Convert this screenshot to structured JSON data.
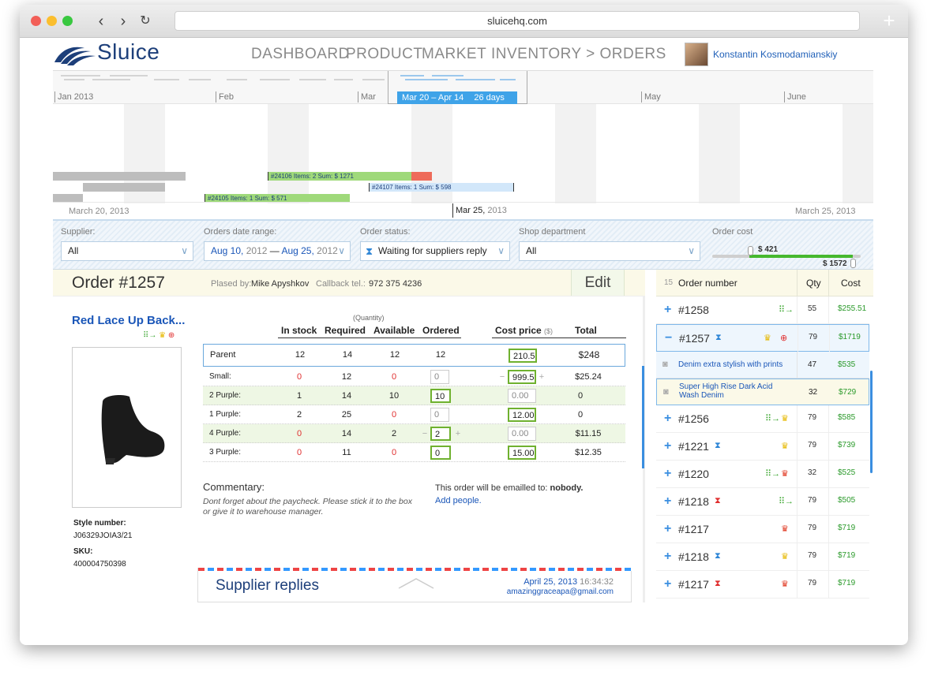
{
  "browser": {
    "url": "sluicehq.com"
  },
  "app": {
    "brand": "Sluice",
    "nav": [
      "DASHBOARD",
      "PRODUCT",
      "MARKET",
      "INVENTORY > ORDERS"
    ],
    "user": "Konstantin Kosmodamianskiy"
  },
  "timeline": {
    "months": [
      "Jan 2013",
      "Feb",
      "Mar",
      "May",
      "June"
    ],
    "range": "Mar 20 – Apr 14",
    "range_days": "26 days",
    "gantt_bars": [
      {
        "label": "#24106   Items: 2   Sum: $ 1271"
      },
      {
        "label": "#24107   Items: 1   Sum: $ 598"
      },
      {
        "label": "#24105   Items: 1   Sum: $ 571"
      }
    ],
    "date_left": "March 20, 2013",
    "date_mid_bold": "Mar 25,",
    "date_mid_year": "2013",
    "date_right": "March 25, 2013"
  },
  "filters": {
    "supplier": {
      "label": "Supplier:",
      "value": "All"
    },
    "date_range": {
      "label": "Orders date range:",
      "from_md": "Aug 10,",
      "from_y": "2012",
      "sep": "—",
      "to_md": "Aug 25,",
      "to_y": "2012"
    },
    "status": {
      "label": "Order status:",
      "value": "Waiting for suppliers reply"
    },
    "department": {
      "label": "Shop department",
      "value": "All"
    },
    "cost": {
      "label": "Order cost",
      "min": "$ 421",
      "max": "$ 1572"
    }
  },
  "order": {
    "title": "Order #1257",
    "placed_by_label": "Plased by:",
    "placed_by": "Mike Apyshkov",
    "callback_label": "Callback tel.:",
    "callback": "972 375 4236",
    "edit_label": "Edit",
    "product_name": "Red Lace Up Back...",
    "style_label": "Style number:",
    "style_value": "J06329JOIA3/21",
    "sku_label": "SKU:",
    "sku_value": "400004750398",
    "quantity_caption": "(Quantity)",
    "headers": [
      "In stock",
      "Required",
      "Available",
      "Ordered",
      "Cost price",
      "Total"
    ],
    "cost_unit": "($)",
    "rows": [
      {
        "name": "Parent",
        "in_stock": "12",
        "required": "14",
        "available": "12",
        "ordered": "12",
        "cost": "210.5",
        "total": "$248"
      },
      {
        "name": "Small:",
        "in_stock": "0",
        "required": "12",
        "available": "0",
        "ordered": "0",
        "cost": "999.5",
        "total": "$25.24"
      },
      {
        "name": "2 Purple:",
        "in_stock": "1",
        "required": "14",
        "available": "10",
        "ordered": "10",
        "cost": "0.00",
        "total": "0"
      },
      {
        "name": "1 Purple:",
        "in_stock": "2",
        "required": "25",
        "available": "0",
        "ordered": "0",
        "cost": "12.00",
        "total": "0"
      },
      {
        "name": "4 Purple:",
        "in_stock": "0",
        "required": "14",
        "available": "2",
        "ordered": "2",
        "cost": "0.00",
        "total": "$11.15"
      },
      {
        "name": "3 Purple:",
        "in_stock": "0",
        "required": "11",
        "available": "0",
        "ordered": "0",
        "cost": "15.00",
        "total": "$12.35"
      }
    ],
    "commentary_label": "Commentary:",
    "commentary": "Dont forget about the paycheck. Please stick it to the box or give it to warehouse manager.",
    "email_prefix": "This order will be emailled to:",
    "email_target": "nobody.",
    "add_people": "Add people.",
    "supplier_replies": "Supplier replies",
    "reply_date": "April 25, 2013",
    "reply_time": "16:34:32",
    "reply_email": "amazinggraceapa@gmail.com"
  },
  "orders_list": {
    "count": "15",
    "col_number": "Order number",
    "col_qty": "Qty",
    "col_cost": "Cost",
    "items": [
      {
        "sign": "+",
        "number": "#1258",
        "qty": "55",
        "cost": "$255.51"
      },
      {
        "sign": "−",
        "number": "#1257",
        "qty": "79",
        "cost": "$1719"
      },
      {
        "sub": true,
        "name": "Denim extra stylish with prints",
        "qty": "47",
        "cost": "$535"
      },
      {
        "sub": true,
        "name": "Super High Rise Dark Acid Wash Denim",
        "qty": "32",
        "cost": "$729"
      },
      {
        "sign": "+",
        "number": "#1256",
        "qty": "79",
        "cost": "$585"
      },
      {
        "sign": "+",
        "number": "#1221",
        "qty": "79",
        "cost": "$739"
      },
      {
        "sign": "+",
        "number": "#1220",
        "qty": "32",
        "cost": "$525"
      },
      {
        "sign": "+",
        "number": "#1218",
        "qty": "79",
        "cost": "$505"
      },
      {
        "sign": "+",
        "number": "#1217",
        "qty": "79",
        "cost": "$719"
      },
      {
        "sign": "+",
        "number": "#1218",
        "qty": "79",
        "cost": "$719"
      },
      {
        "sign": "+",
        "number": "#1217",
        "qty": "79",
        "cost": "$719"
      }
    ]
  },
  "colors": {
    "brand": "#1d3f7a",
    "link": "#1a56b8",
    "accent": "#3fa3e8",
    "green": "#6fb12f",
    "red": "#e03030"
  }
}
